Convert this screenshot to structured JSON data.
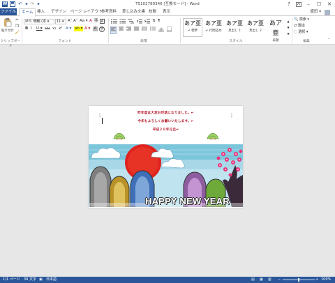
{
  "window": {
    "title": "TS102780346 [互換モード] - Word",
    "help": "?",
    "minimize_glyph": "–",
    "maximize_glyph": "☐",
    "close_glyph": "✕"
  },
  "quick_access": {
    "undo": "↶",
    "redo": "↷",
    "more": "▾"
  },
  "tabs": {
    "file": "ファイル",
    "items": [
      "ホーム",
      "挿入",
      "デザイン",
      "ページ レイアウト",
      "参考資料",
      "差し込み文書",
      "校閲",
      "表示"
    ],
    "active": "ホーム",
    "user": "盛田 ▾"
  },
  "ribbon": {
    "clipboard": {
      "paste": "貼り付け",
      "label": "クリップボード"
    },
    "font": {
      "name": "ＭＳ 明朝 (本 ▾",
      "size": "11 ▾",
      "grow": "A˄",
      "shrink": "A˅",
      "case": "Aa ▾",
      "clear": "A",
      "phonetic": "亜",
      "enclose": "A",
      "bold": "B",
      "italic": "I",
      "underline": "U ▾",
      "strike": "abc",
      "subscript": "x₂",
      "superscript": "x²",
      "effects": "A ▾",
      "highlight": "ab ▾",
      "color": "A ▾",
      "shade": "A",
      "border": "字",
      "label": "フォント"
    },
    "paragraph": {
      "label": "段落",
      "sort": "⇅",
      "marks": "¶"
    },
    "styles": {
      "items": [
        {
          "sample": "あア亜",
          "name": "↵ 標準"
        },
        {
          "sample": "あア亜",
          "name": "↵ 行間詰め"
        },
        {
          "sample": "あア亜",
          "name": "見出し 1"
        },
        {
          "sample": "あア亜",
          "name": "見出し 2"
        },
        {
          "sample": "あア亜",
          "name": "表題"
        }
      ],
      "label": "スタイル"
    },
    "editing": {
      "find": "検索 ▾",
      "replace": "置換",
      "select": "選択 ▾",
      "label": "編集"
    }
  },
  "document": {
    "lines": [
      "昨年度は大変お世話になりました。↵",
      "今年もよろしくお願いいたします。↵",
      "平成２８年元旦↵"
    ],
    "card_text": "HAPPY NEW YEAR"
  },
  "status": {
    "page": "1/1 ページ",
    "words": "39 文字",
    "lang": "日本語",
    "zoom": "100%",
    "zoom_minus": "−",
    "zoom_plus": "+"
  }
}
